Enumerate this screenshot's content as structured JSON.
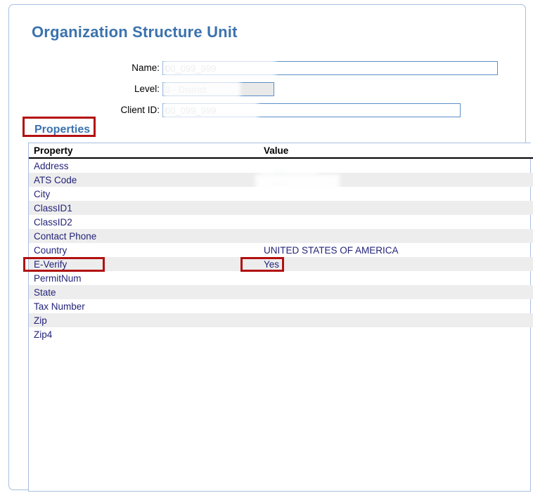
{
  "page": {
    "title": "Organization Structure Unit"
  },
  "form": {
    "fields": [
      {
        "label": "Name:",
        "value": "00_099_999",
        "redacted": true,
        "disabled": false
      },
      {
        "label": "Level:",
        "value": "3 - District",
        "redacted": true,
        "disabled": true
      },
      {
        "label": "Client ID:",
        "value": "00_099_999",
        "redacted": true,
        "disabled": false
      }
    ]
  },
  "properties_section": {
    "heading": "Properties",
    "table": {
      "columns": [
        "Property",
        "Value"
      ],
      "rows": [
        {
          "property": "Address",
          "value": ""
        },
        {
          "property": "ATS Code",
          "value": ""
        },
        {
          "property": "City",
          "value": ""
        },
        {
          "property": "ClassID1",
          "value": ""
        },
        {
          "property": "ClassID2",
          "value": ""
        },
        {
          "property": "Contact Phone",
          "value": ""
        },
        {
          "property": "Country",
          "value": "UNITED STATES OF AMERICA"
        },
        {
          "property": "E-Verify",
          "value": "Yes"
        },
        {
          "property": "PermitNum",
          "value": ""
        },
        {
          "property": "State",
          "value": ""
        },
        {
          "property": "Tax Number",
          "value": ""
        },
        {
          "property": "Zip",
          "value": ""
        },
        {
          "property": "Zip4",
          "value": ""
        }
      ]
    }
  },
  "annotations": [
    {
      "name": "properties-heading-highlight",
      "target": "Properties"
    },
    {
      "name": "e-verify-label-highlight",
      "target": "E-Verify"
    },
    {
      "name": "e-verify-value-highlight",
      "target": "Yes"
    }
  ],
  "colors": {
    "title_blue": "#3b72ad",
    "panel_border": "#a8bfe0",
    "property_text": "#23237a",
    "row_alt_bg": "#ededed",
    "annotation_red": "#b31010",
    "input_border": "#5c8fc9",
    "disabled_bg": "#e9e9e9"
  }
}
